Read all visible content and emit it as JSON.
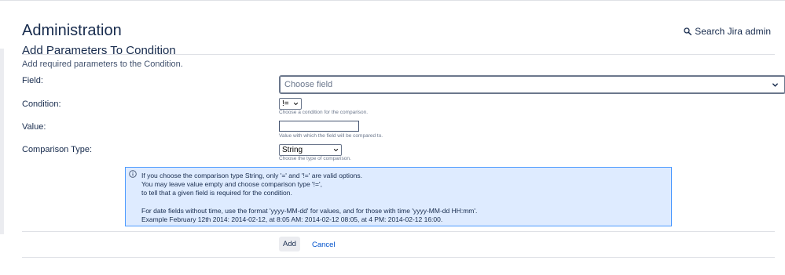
{
  "header": {
    "title": "Administration",
    "search_label": "Search Jira admin"
  },
  "form": {
    "title": "Add Parameters To Condition",
    "description": "Add required parameters to the Condition.",
    "field": {
      "label": "Field:",
      "placeholder": "Choose field"
    },
    "condition": {
      "label": "Condition:",
      "selected": "!=",
      "hint": "Choose a condition for the comparison."
    },
    "value": {
      "label": "Value:",
      "current": "",
      "hint": "Value with which the field will be compared to."
    },
    "comparison_type": {
      "label": "Comparison Type:",
      "selected": "String",
      "hint": "Choose the type of comparison."
    },
    "info": {
      "icon": "info-icon",
      "lines": [
        "If you choose the comparison type String, only '=' and '!=' are valid options.",
        "You may leave value empty and choose comparison type '!=',",
        "to tell that a given field is required for the condition.",
        "For date fields without time, use the format 'yyyy-MM-dd' for values, and for those with time 'yyyy-MM-dd HH:mm'.",
        "Example February 12th 2014: 2014-02-12, at 8:05 AM: 2014-02-12 08:05, at 4 PM: 2014-02-12 16:00."
      ]
    },
    "buttons": {
      "add": "Add",
      "cancel": "Cancel"
    }
  },
  "colors": {
    "text": "#172b4d",
    "link": "#0052cc",
    "info_bg": "#deebff",
    "info_border": "#4c9aff",
    "button_bg": "#ebecf0"
  }
}
